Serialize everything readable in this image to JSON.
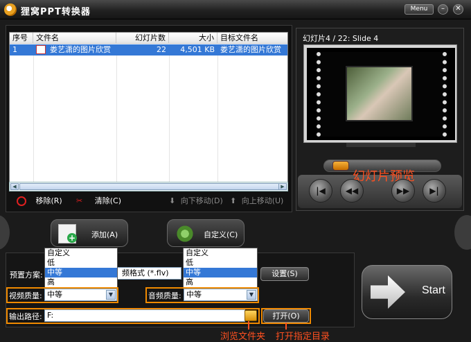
{
  "window": {
    "title": "狸窝PPT转换器",
    "menu_label": "Menu",
    "minimize": "–",
    "close": "✕"
  },
  "file_list": {
    "headers": [
      "序号",
      "文件名",
      "幻灯片数",
      "大小",
      "目标文件名"
    ],
    "rows": [
      {
        "index": "1",
        "name": "娄艺潇的图片欣赏",
        "slides": "22",
        "size": "4,501 KB",
        "target": "娄艺潇的图片欣赏"
      }
    ]
  },
  "toolbar": {
    "remove": "移除(R)",
    "clear": "清除(C)",
    "move_down": "向下移动(D)",
    "move_up": "向上移动(U)"
  },
  "preview": {
    "slide_label": "幻灯片4 / 22: Slide 4",
    "annotation": "幻灯片预览"
  },
  "actions": {
    "add": "添加(A)",
    "custom": "自定义(C)",
    "start": "Start"
  },
  "settings": {
    "preset_label": "预置方案:",
    "preset_value": "频格式 (*.flv)",
    "settings_button": "设置(S)",
    "video_quality_label": "视频质量:",
    "video_quality_value": "中等",
    "audio_quality_label": "音频质量:",
    "audio_quality_value": "中等",
    "output_label": "输出路径:",
    "output_value": "F:",
    "open_button": "打开(O)",
    "quality_options": [
      "自定义",
      "低",
      "中等",
      "高"
    ]
  },
  "annotations": {
    "browse": "浏览文件夹",
    "open_dir": "打开指定目录"
  },
  "colors": {
    "selection": "#3478d6",
    "highlight_border": "#f08a00",
    "annotation_text": "#ff5020"
  }
}
